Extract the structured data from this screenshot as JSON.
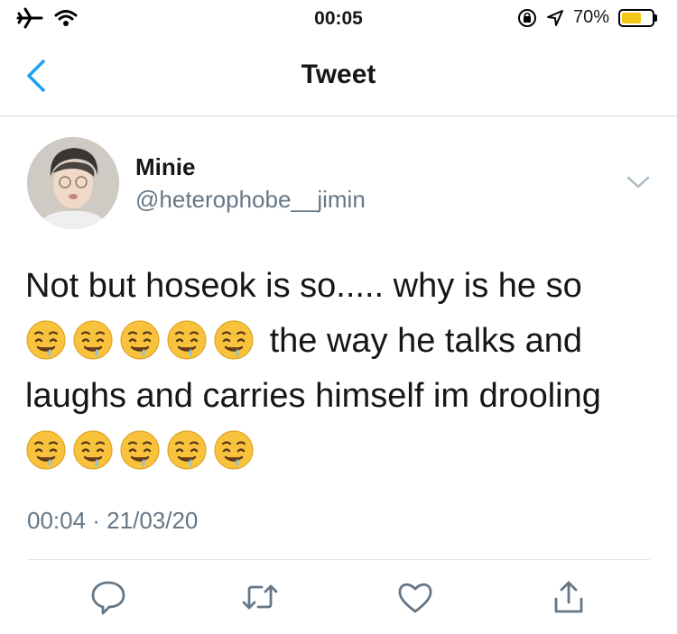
{
  "status_bar": {
    "time": "00:05",
    "battery_text": "70%",
    "battery_level": 0.7,
    "left_icons": [
      "airplane-icon",
      "wifi-icon"
    ],
    "right_icons": [
      "orientation-lock-icon",
      "location-icon",
      "battery-icon"
    ],
    "battery_color": "#f5c518"
  },
  "nav": {
    "title": "Tweet",
    "back_icon": "chevron-left-icon",
    "accent": "#1da1f2"
  },
  "tweet": {
    "author_name": "Minie",
    "author_handle": "@heterophobe__jimin",
    "line1": "Not but hoseok is so..... why is he so",
    "line2_text": "the way he talks and",
    "line3": "laughs and carries himself im drooling",
    "emoji": "drooling-face",
    "timestamp": "00:04 · 21/03/20"
  },
  "actions": [
    "reply-icon",
    "retweet-icon",
    "like-icon",
    "share-icon"
  ]
}
